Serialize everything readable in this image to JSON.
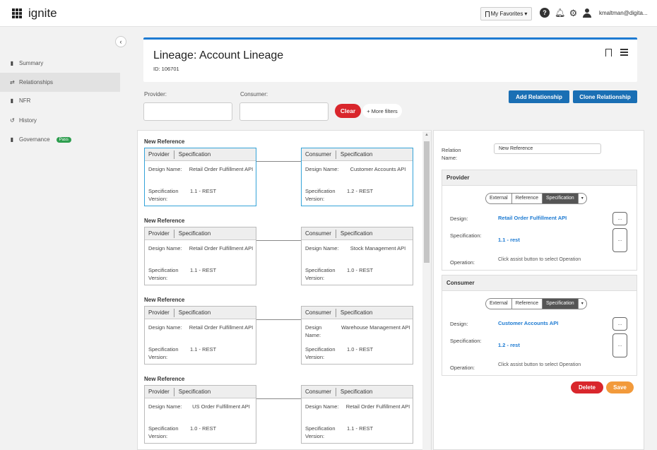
{
  "app": {
    "brand": "ignite"
  },
  "topbar": {
    "favorites_label": "My Favorites",
    "help_label": "?",
    "username": "kmaltman@digita..."
  },
  "sidebar": {
    "items": [
      {
        "label": "Summary",
        "icon": "document-icon"
      },
      {
        "label": "Relationships",
        "icon": "relationship-icon"
      },
      {
        "label": "NFR",
        "icon": "document-icon"
      },
      {
        "label": "History",
        "icon": "history-icon"
      },
      {
        "label": "Governance",
        "icon": "governance-icon",
        "badge": "Pass"
      }
    ],
    "active_index": 1
  },
  "header": {
    "title": "Lineage: Account Lineage",
    "id_text": "ID: 106701"
  },
  "filters": {
    "provider_label": "Provider:",
    "consumer_label": "Consumer:",
    "clear_label": "Clear",
    "more_filters_label": "+ More filters"
  },
  "actions": {
    "add_relationship": "Add Relationship",
    "clone_relationship": "Clone Relationship"
  },
  "relationships": [
    {
      "title": "New Reference",
      "provider": {
        "head_a": "Provider",
        "head_b": "Specification",
        "design_label": "Design Name:",
        "design": "Retail Order Fulfillment API",
        "spec_label": "Specification Version:",
        "spec": "1.1 - REST"
      },
      "consumer": {
        "head_a": "Consumer",
        "head_b": "Specification",
        "design_label": "Design Name:",
        "design": "Customer Accounts API",
        "spec_label": "Specification Version:",
        "spec": "1.2 - REST"
      }
    },
    {
      "title": "New Reference",
      "provider": {
        "head_a": "Provider",
        "head_b": "Specification",
        "design_label": "Design Name:",
        "design": "Retail Order Fulfillment API",
        "spec_label": "Specification Version:",
        "spec": "1.1 - REST"
      },
      "consumer": {
        "head_a": "Consumer",
        "head_b": "Specification",
        "design_label": "Design Name:",
        "design": "Stock Management API",
        "spec_label": "Specification Version:",
        "spec": "1.0 - REST"
      }
    },
    {
      "title": "New Reference",
      "provider": {
        "head_a": "Provider",
        "head_b": "Specification",
        "design_label": "Design Name:",
        "design": "Retail Order Fulfillment API",
        "spec_label": "Specification Version:",
        "spec": "1.1 - REST"
      },
      "consumer": {
        "head_a": "Consumer",
        "head_b": "Specification",
        "design_label": "Design Name:",
        "design": "Warehouse Management API",
        "spec_label": "Specification Version:",
        "spec": "1.0 - REST"
      }
    },
    {
      "title": "New Reference",
      "provider": {
        "head_a": "Provider",
        "head_b": "Specification",
        "design_label": "Design Name:",
        "design": "US Order Fulfillment API",
        "spec_label": "Specification Version:",
        "spec": "1.0 - REST"
      },
      "consumer": {
        "head_a": "Consumer",
        "head_b": "Specification",
        "design_label": "Design Name:",
        "design": "Retail Order Fulfillment API",
        "spec_label": "Specification Version:",
        "spec": "1.1 - REST"
      }
    }
  ],
  "detail": {
    "relation_name_label": "Relation Name:",
    "relation_name_value": "New Reference",
    "provider": {
      "section_title": "Provider",
      "seg": [
        "External",
        "Reference",
        "Specification"
      ],
      "design_label": "Design:",
      "design_value": "Retail Order Fulfillment API",
      "spec_label": "Specification:",
      "spec_value": "1.1 - rest",
      "op_label": "Operation:",
      "op_hint": "Click assist button to select Operation",
      "dots": "..."
    },
    "consumer": {
      "section_title": "Consumer",
      "seg": [
        "External",
        "Reference",
        "Specification"
      ],
      "design_label": "Design:",
      "design_value": "Customer Accounts API",
      "spec_label": "Specification:",
      "spec_value": "1.2 - rest",
      "op_label": "Operation:",
      "op_hint": "Click assist button to select Operation",
      "dots": "..."
    },
    "delete_label": "Delete",
    "save_label": "Save"
  },
  "colors": {
    "accent_blue": "#1e7bd2",
    "button_blue": "#1a6fb4",
    "danger_red": "#d9262c",
    "save_orange": "#f29a3b",
    "pass_green": "#2e9e4f",
    "selected_border": "#34a3d8"
  }
}
